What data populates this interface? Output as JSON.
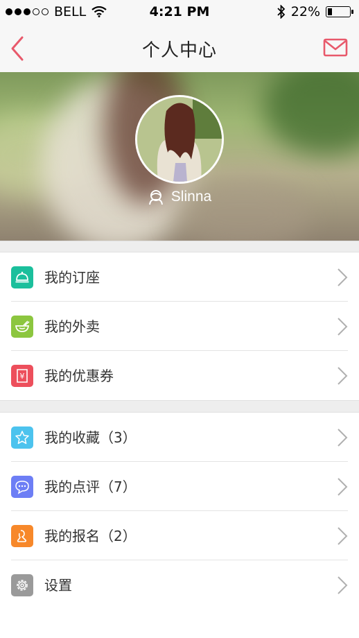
{
  "status_bar": {
    "carrier": "BELL",
    "time": "4:21 PM",
    "battery_percent": "22%",
    "battery_level": 0.22,
    "signal_bars_filled": 3,
    "signal_bars_total": 5
  },
  "nav": {
    "title": "个人中心",
    "back_icon": "chevron-left-icon",
    "mail_icon": "mail-icon",
    "accent_color": "#e8596b"
  },
  "profile": {
    "username": "Slinna",
    "user_icon": "user-outline-icon"
  },
  "menu_group_1": [
    {
      "label": "我的订座",
      "icon": "service-bell-icon",
      "color": "#1bbf9c"
    },
    {
      "label": "我的外卖",
      "icon": "takeout-bowl-icon",
      "color": "#8cc63f"
    },
    {
      "label": "我的优惠券",
      "icon": "coupon-yen-icon",
      "color": "#ed4f5c"
    }
  ],
  "menu_group_2": [
    {
      "label": "我的收藏（3）",
      "icon": "star-icon",
      "color": "#4cc3ee"
    },
    {
      "label": "我的点评（7）",
      "icon": "comment-icon",
      "color": "#6d7ef5"
    },
    {
      "label": "我的报名（2）",
      "icon": "signup-icon",
      "color": "#f7882a"
    },
    {
      "label": "设置",
      "icon": "gear-icon",
      "color": "#9a9a9a"
    }
  ]
}
